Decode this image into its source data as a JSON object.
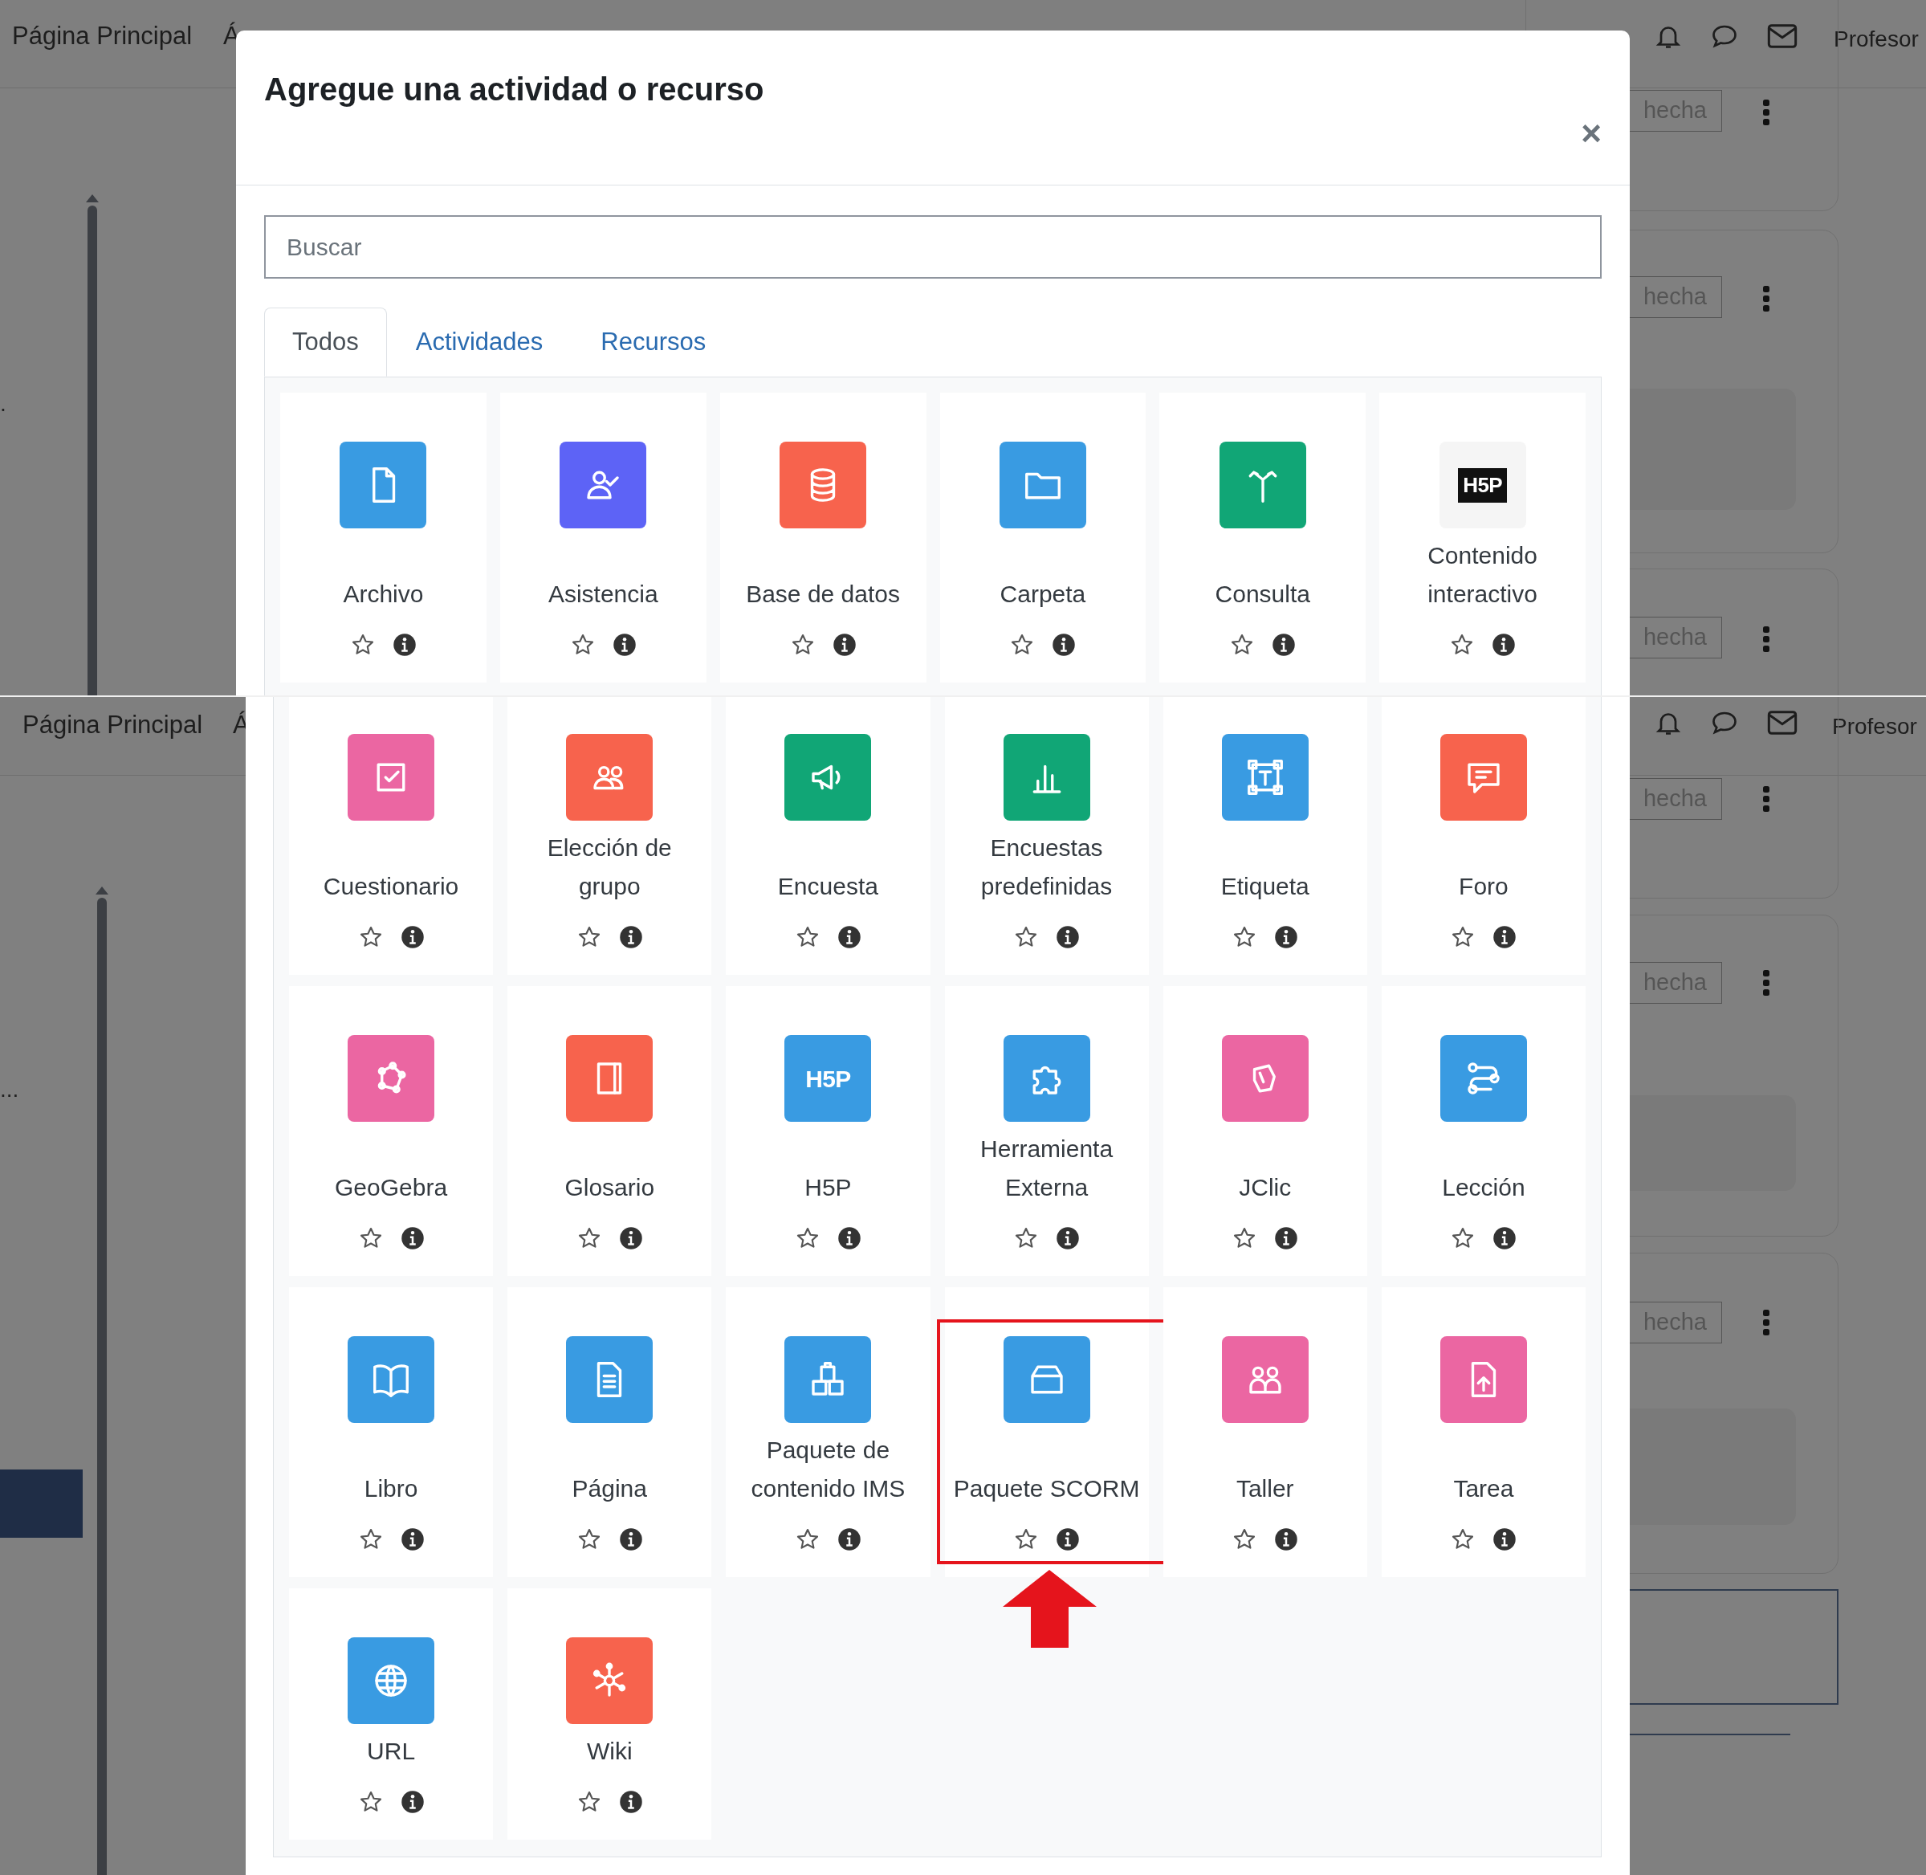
{
  "screens": [
    {
      "nav": {
        "items": [
          "Página Principal",
          "Á"
        ],
        "user": "Profesor"
      },
      "page": {
        "side_text": ".",
        "buttons": [
          "hecha",
          "hecha",
          "hecha"
        ]
      },
      "modal": {
        "title": "Agregue una actividad o recurso",
        "close": "×",
        "search": {
          "placeholder": "Buscar"
        },
        "tabs": [
          {
            "label": "Todos",
            "selected": true
          },
          {
            "label": "Actividades",
            "selected": false
          },
          {
            "label": "Recursos",
            "selected": false
          }
        ],
        "items": [
          {
            "label": "Archivo",
            "kind": "file",
            "color": "#399be2",
            "starred": false,
            "highlighted": false
          },
          {
            "label": "Asistencia",
            "kind": "attendance",
            "color": "#5d63f6",
            "starred": false,
            "highlighted": false
          },
          {
            "label": "Base de datos",
            "kind": "database",
            "color": "#f7634d",
            "starred": false,
            "highlighted": false
          },
          {
            "label": "Carpeta",
            "kind": "folder",
            "color": "#399be2",
            "starred": false,
            "highlighted": false
          },
          {
            "label": "Consulta",
            "kind": "signpost",
            "color": "#11a676",
            "starred": false,
            "highlighted": false
          },
          {
            "label": "Contenido interactivo",
            "kind": "logo",
            "logo_text": "H5P",
            "color": "#f5f5f5",
            "starred": false,
            "highlighted": false
          }
        ]
      }
    },
    {
      "nav": {
        "items": [
          "Página Principal",
          "Á"
        ],
        "user": "Profesor"
      },
      "page": {
        "side_text": "...",
        "buttons": [
          "hecha",
          "hecha",
          "hecha"
        ]
      },
      "modal": {
        "items": [
          {
            "label": "Cuestionario",
            "kind": "check",
            "color": "#eb66a2",
            "starred": false,
            "highlighted": false
          },
          {
            "label": "Elección de grupo",
            "kind": "users",
            "color": "#f7634d",
            "starred": false,
            "highlighted": false
          },
          {
            "label": "Encuesta",
            "kind": "megaphone",
            "color": "#11a676",
            "starred": false,
            "highlighted": false
          },
          {
            "label": "Encuestas predefinidas",
            "kind": "chart",
            "color": "#11a676",
            "starred": false,
            "highlighted": false
          },
          {
            "label": "Etiqueta",
            "kind": "frame",
            "color": "#399be2",
            "starred": false,
            "highlighted": false
          },
          {
            "label": "Foro",
            "kind": "chat",
            "color": "#f7634d",
            "starred": false,
            "highlighted": false
          },
          {
            "label": "GeoGebra",
            "kind": "polygon",
            "color": "#eb66a2",
            "starred": false,
            "highlighted": false
          },
          {
            "label": "Glosario",
            "kind": "notebook",
            "color": "#f7634d",
            "starred": false,
            "highlighted": false
          },
          {
            "label": "H5P",
            "kind": "logo",
            "logo_text": "H5P",
            "color": "#399be2",
            "starred": false,
            "highlighted": false
          },
          {
            "label": "Herramienta Externa",
            "kind": "puzzle",
            "color": "#399be2",
            "starred": false,
            "highlighted": false
          },
          {
            "label": "JClic",
            "kind": "hand",
            "color": "#eb66a2",
            "starred": false,
            "highlighted": false
          },
          {
            "label": "Lección",
            "kind": "route",
            "color": "#399be2",
            "starred": false,
            "highlighted": false
          },
          {
            "label": "Libro",
            "kind": "book",
            "color": "#399be2",
            "starred": false,
            "highlighted": false
          },
          {
            "label": "Página",
            "kind": "page",
            "color": "#399be2",
            "starred": false,
            "highlighted": false
          },
          {
            "label": "Paquete de contenido IMS",
            "kind": "boxes",
            "color": "#399be2",
            "starred": false,
            "highlighted": false
          },
          {
            "label": "Paquete SCORM",
            "kind": "box",
            "color": "#399be2",
            "starred": false,
            "highlighted": true
          },
          {
            "label": "Taller",
            "kind": "people",
            "color": "#eb66a2",
            "starred": false,
            "highlighted": false
          },
          {
            "label": "Tarea",
            "kind": "upload",
            "color": "#eb66a2",
            "starred": false,
            "highlighted": false
          },
          {
            "label": "URL",
            "kind": "globe",
            "color": "#399be2",
            "starred": false,
            "highlighted": false
          },
          {
            "label": "Wiki",
            "kind": "network",
            "color": "#f7634d",
            "starred": false,
            "highlighted": false
          }
        ]
      }
    }
  ]
}
